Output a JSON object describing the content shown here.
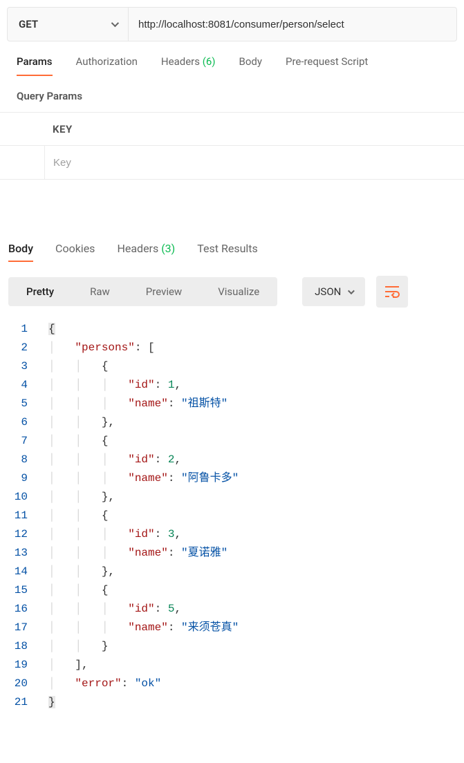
{
  "request": {
    "method": "GET",
    "url": "http://localhost:8081/consumer/person/select"
  },
  "reqTabs": {
    "params": "Params",
    "authorization": "Authorization",
    "headers": "Headers",
    "headersCount": "(6)",
    "body": "Body",
    "prereq": "Pre-request Script"
  },
  "queryParams": {
    "title": "Query Params",
    "keyHeader": "KEY",
    "keyPlaceholder": "Key"
  },
  "respTabs": {
    "body": "Body",
    "cookies": "Cookies",
    "headers": "Headers",
    "headersCount": "(3)",
    "testResults": "Test Results"
  },
  "viewModes": {
    "pretty": "Pretty",
    "raw": "Raw",
    "preview": "Preview",
    "visualize": "Visualize",
    "lang": "JSON"
  },
  "code": {
    "l1": "{",
    "l2_k": "\"persons\"",
    "l2_p": ": [",
    "l3": "{",
    "l4_k": "\"id\"",
    "l4_p": ": ",
    "l4_v": "1",
    "l4_c": ",",
    "l5_k": "\"name\"",
    "l5_p": ": ",
    "l5_v": "\"祖斯特\"",
    "l6": "},",
    "l7": "{",
    "l8_k": "\"id\"",
    "l8_p": ": ",
    "l8_v": "2",
    "l8_c": ",",
    "l9_k": "\"name\"",
    "l9_p": ": ",
    "l9_v": "\"阿鲁卡多\"",
    "l10": "},",
    "l11": "{",
    "l12_k": "\"id\"",
    "l12_p": ": ",
    "l12_v": "3",
    "l12_c": ",",
    "l13_k": "\"name\"",
    "l13_p": ": ",
    "l13_v": "\"夏诺雅\"",
    "l14": "},",
    "l15": "{",
    "l16_k": "\"id\"",
    "l16_p": ": ",
    "l16_v": "5",
    "l16_c": ",",
    "l17_k": "\"name\"",
    "l17_p": ": ",
    "l17_v": "\"来须苍真\"",
    "l18": "}",
    "l19": "],",
    "l20_k": "\"error\"",
    "l20_p": ": ",
    "l20_v": "\"ok\"",
    "l21": "}",
    "ln1": "1",
    "ln2": "2",
    "ln3": "3",
    "ln4": "4",
    "ln5": "5",
    "ln6": "6",
    "ln7": "7",
    "ln8": "8",
    "ln9": "9",
    "ln10": "10",
    "ln11": "11",
    "ln12": "12",
    "ln13": "13",
    "ln14": "14",
    "ln15": "15",
    "ln16": "16",
    "ln17": "17",
    "ln18": "18",
    "ln19": "19",
    "ln20": "20",
    "ln21": "21"
  }
}
